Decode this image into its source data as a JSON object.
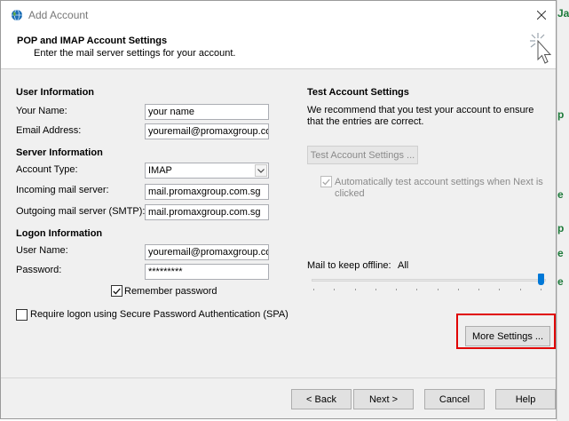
{
  "window": {
    "title": "Add Account",
    "icon": "outlook-globe-icon"
  },
  "header": {
    "title": "POP and IMAP Account Settings",
    "subtitle": "Enter the mail server settings for your account.",
    "icon": "cursor-click-icon"
  },
  "user_info": {
    "heading": "User Information",
    "name_label": "Your Name:",
    "name_value": "your name",
    "email_label": "Email Address:",
    "email_value": "youremail@promaxgroup.com"
  },
  "server_info": {
    "heading": "Server Information",
    "account_type_label": "Account Type:",
    "account_type_value": "IMAP",
    "incoming_label": "Incoming mail server:",
    "incoming_value": "mail.promaxgroup.com.sg",
    "outgoing_label": "Outgoing mail server (SMTP):",
    "outgoing_value": "mail.promaxgroup.com.sg"
  },
  "logon_info": {
    "heading": "Logon Information",
    "username_label": "User Name:",
    "username_value": "youremail@promaxgroup.com",
    "password_label": "Password:",
    "password_value": "*********",
    "remember_label": "Remember password",
    "remember_checked": true,
    "spa_label": "Require logon using Secure Password Authentication (SPA)",
    "spa_checked": false
  },
  "test_settings": {
    "heading": "Test Account Settings",
    "description": "We recommend that you test your account to ensure that the entries are correct.",
    "test_button": "Test Account Settings ...",
    "auto_test_label": "Automatically test account settings when Next is clicked",
    "auto_test_checked": true
  },
  "offline": {
    "label": "Mail to keep offline:",
    "value": "All",
    "level": 1.0
  },
  "buttons": {
    "more_settings": "More Settings ...",
    "back": "< Back",
    "next": "Next >",
    "cancel": "Cancel",
    "help": "Help"
  },
  "background_fragments": [
    "Ja",
    "p",
    "e",
    "p",
    "e",
    "e"
  ],
  "colors": {
    "dialog_bg": "#f0f0f0",
    "highlight": "#e00000",
    "slider": "#0078d7"
  }
}
